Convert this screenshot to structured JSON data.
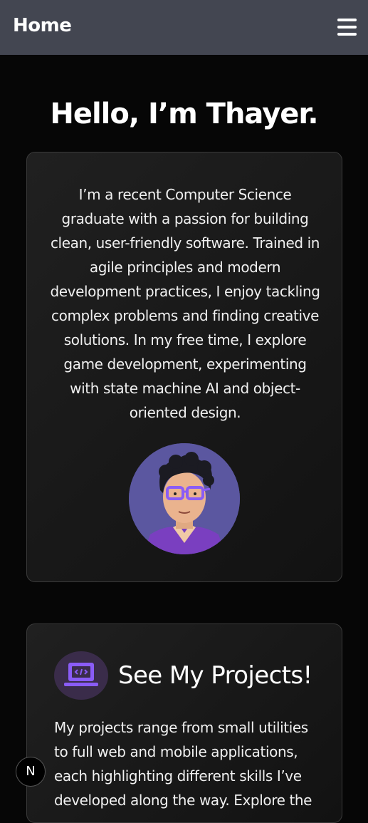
{
  "header": {
    "title": "Home",
    "menu_icon": "hamburger-menu-icon"
  },
  "hero": {
    "title": "Hello, I’m Thayer."
  },
  "about": {
    "text": "I’m a recent Computer Science graduate with a passion for building clean, user-friendly software. Trained in agile principles and modern development practices, I enjoy tackling complex problems and finding creative solutions. In my free time, I explore game development, experimenting with state machine AI and object-oriented design.",
    "avatar_icon": "profile-avatar-illustration"
  },
  "projects": {
    "icon": "laptop-code-icon",
    "title": "See My Projects!",
    "text": "My projects range from small utilities to full web and mobile applications, each highlighting different skills I’ve developed along the way. Explore the"
  },
  "badge": {
    "label": "N"
  },
  "colors": {
    "topbar": "#434651",
    "background": "#060606",
    "icon_accent": "#8a5cf6"
  }
}
